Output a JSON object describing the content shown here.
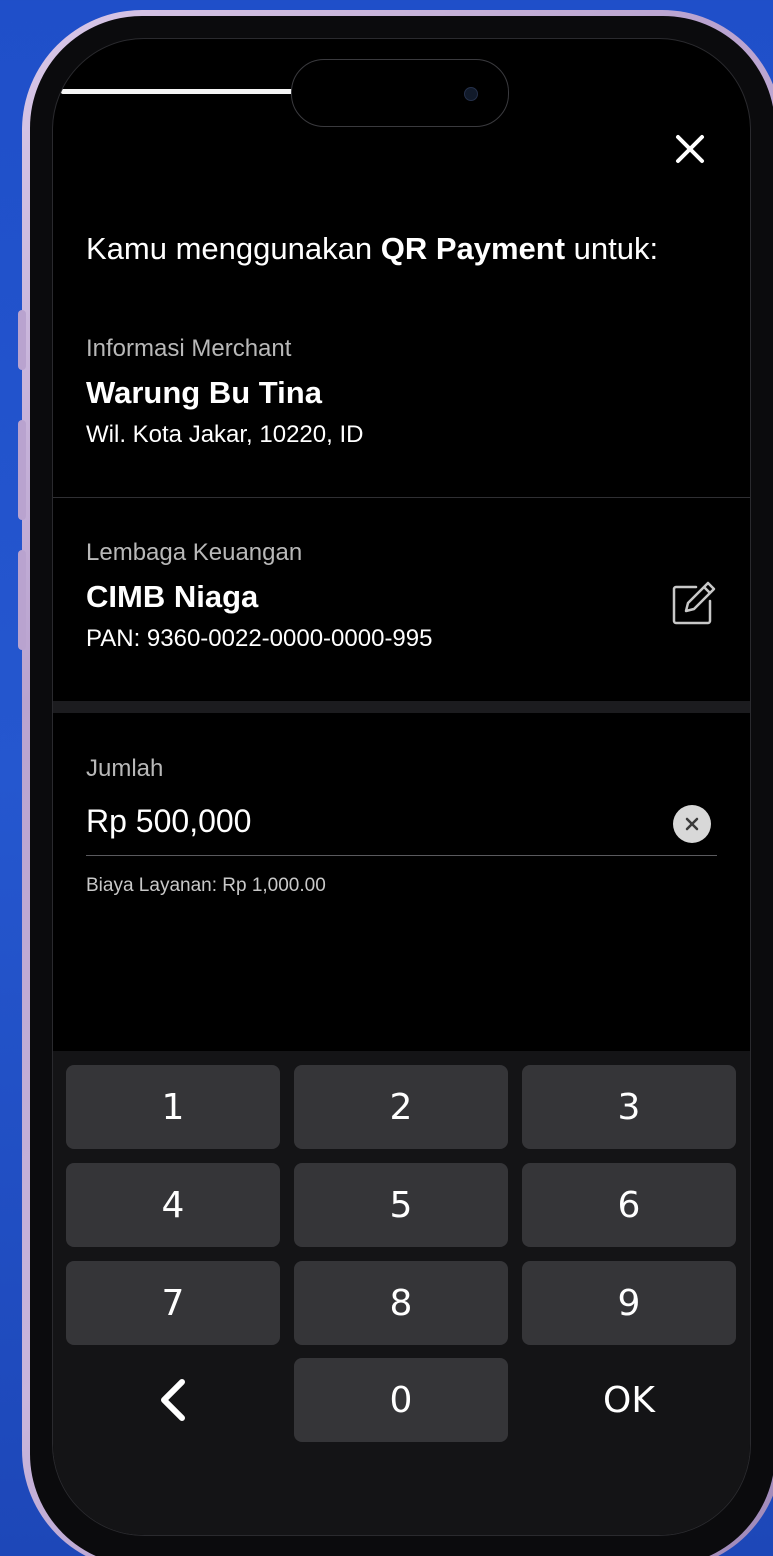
{
  "heading": {
    "prefix": "Kamu menggunakan ",
    "bold": "QR Payment",
    "suffix": " untuk:"
  },
  "merchant": {
    "label": "Informasi Merchant",
    "name": "Warung Bu Tina",
    "address": "Wil. Kota Jakar, 10220, ID"
  },
  "institution": {
    "label": "Lembaga Keuangan",
    "name": "CIMB Niaga",
    "pan": "PAN: 9360-0022-0000-0000-995"
  },
  "amount": {
    "label": "Jumlah",
    "value": "Rp 500,000",
    "fee": "Biaya Layanan: Rp 1,000.00"
  },
  "keypad": {
    "k1": "1",
    "k2": "2",
    "k3": "3",
    "k4": "4",
    "k5": "5",
    "k6": "6",
    "k7": "7",
    "k8": "8",
    "k9": "9",
    "k0": "0",
    "back": "‹",
    "ok": "OK"
  },
  "icons": {
    "close": "close-icon",
    "edit": "edit-icon",
    "clear": "clear-icon",
    "back": "chevron-left-icon"
  },
  "colors": {
    "background": "#000000",
    "keypad_key": "#353538",
    "frame_accent": "#c9b5dc"
  }
}
